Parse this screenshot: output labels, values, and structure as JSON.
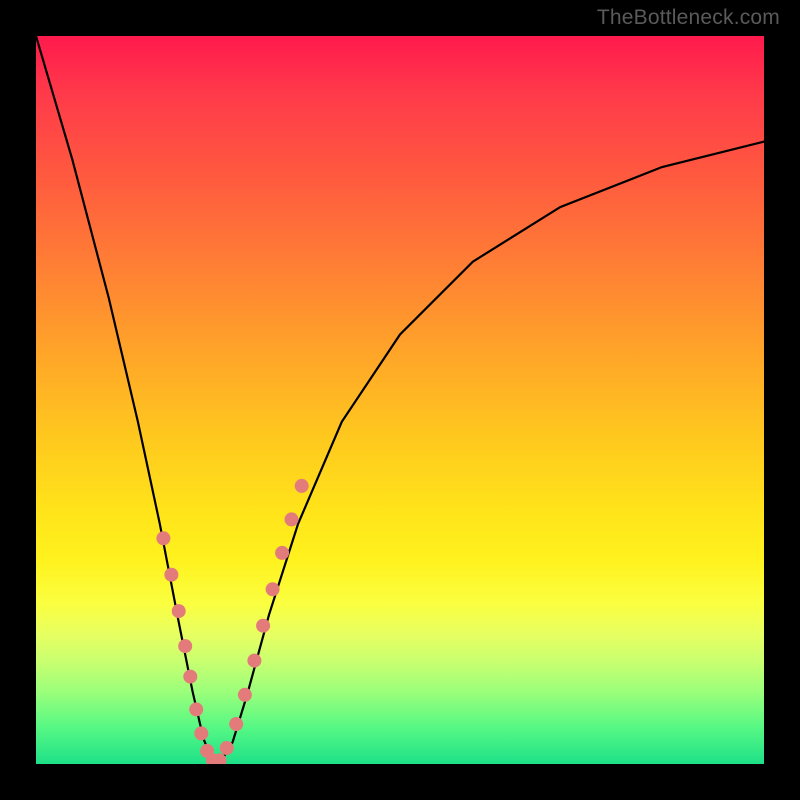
{
  "watermark": {
    "text": "TheBottleneck.com"
  },
  "colors": {
    "frame": "#000000",
    "curve_stroke": "#000000",
    "dot_fill": "#e47b7b",
    "gradient_top": "#ff1a4d",
    "gradient_bottom": "#1ee088"
  },
  "chart_data": {
    "type": "line",
    "title": "",
    "xlabel": "",
    "ylabel": "",
    "xlim": [
      0,
      1
    ],
    "ylim": [
      0,
      1
    ],
    "notes": "No axis ticks or numeric labels are rendered; values are normalized 0–1 in both directions. Curve models bottleneck percentage: value drops to ~0 at the optimum (~x=0.25) and rises on either side. Dots appear to be sample points on the curve near the trough.",
    "series": [
      {
        "name": "bottleneck-curve",
        "x": [
          0.0,
          0.05,
          0.1,
          0.14,
          0.17,
          0.195,
          0.215,
          0.23,
          0.242,
          0.255,
          0.27,
          0.29,
          0.32,
          0.36,
          0.42,
          0.5,
          0.6,
          0.72,
          0.86,
          1.0
        ],
        "values": [
          1.0,
          0.83,
          0.64,
          0.47,
          0.33,
          0.2,
          0.1,
          0.035,
          0.005,
          0.005,
          0.03,
          0.095,
          0.205,
          0.33,
          0.47,
          0.59,
          0.69,
          0.765,
          0.82,
          0.855
        ]
      },
      {
        "name": "sample-dots",
        "x": [
          0.175,
          0.186,
          0.196,
          0.205,
          0.212,
          0.22,
          0.227,
          0.235,
          0.243,
          0.252,
          0.262,
          0.275,
          0.287,
          0.3,
          0.312,
          0.325,
          0.338,
          0.351,
          0.365
        ],
        "values": [
          0.31,
          0.26,
          0.21,
          0.162,
          0.12,
          0.075,
          0.042,
          0.018,
          0.005,
          0.005,
          0.022,
          0.055,
          0.095,
          0.142,
          0.19,
          0.24,
          0.29,
          0.336,
          0.382
        ]
      }
    ]
  }
}
